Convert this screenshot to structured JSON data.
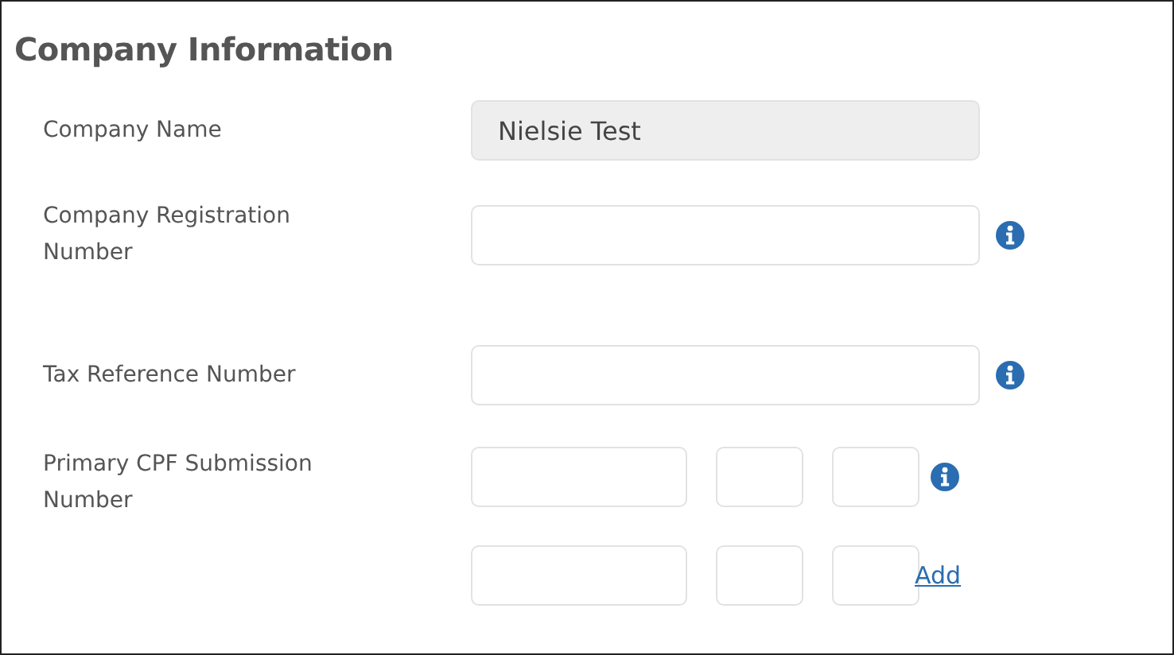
{
  "section_title": "Company Information",
  "fields": [
    {
      "kind": "text",
      "label": "Company Name",
      "value": "Nielsie Test",
      "disabled": true,
      "info": false
    },
    {
      "kind": "text",
      "label": "Company Registration Number",
      "disabled": false,
      "info": true
    },
    {
      "kind": "text",
      "label": "Tax Reference Number",
      "disabled": false,
      "info": true
    },
    {
      "kind": "split",
      "label": "Primary CPF Submission Number",
      "info": true,
      "add_link": "Add"
    }
  ]
}
